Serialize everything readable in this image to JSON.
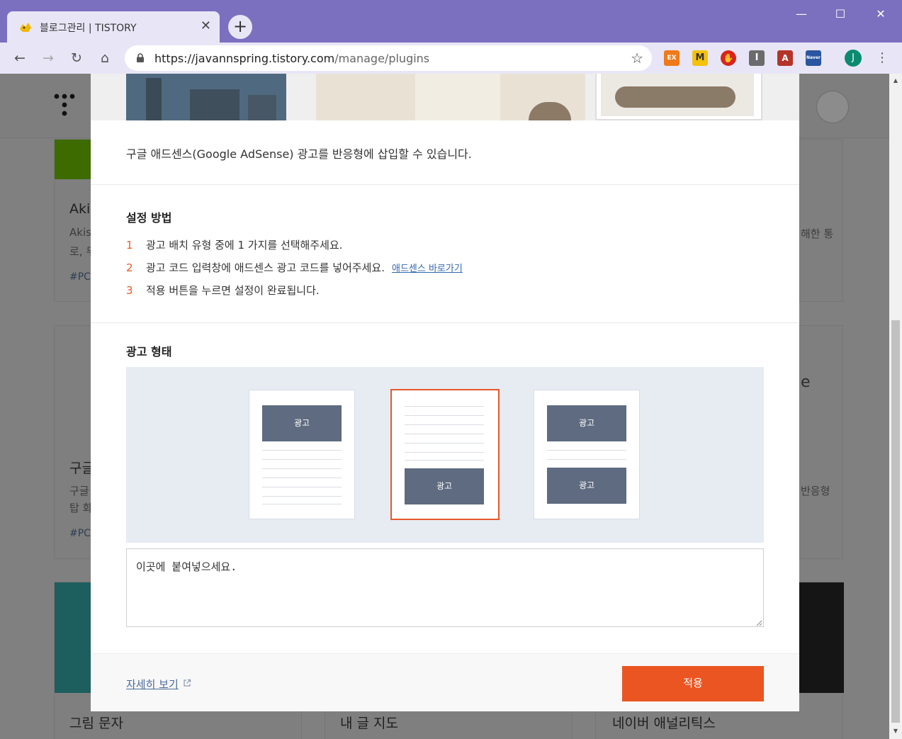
{
  "browser": {
    "tab_title": "블로그관리 | TISTORY",
    "tab_close": "✕",
    "new_tab": "+",
    "window": {
      "minimize": "—",
      "maximize": "☐",
      "close": "✕"
    },
    "nav": {
      "back": "←",
      "forward": "→",
      "reload": "↻",
      "home": "⌂"
    },
    "url_host": "https://javannspring.tistory.com",
    "url_path": "/manage/plugins",
    "bookmark_star": "☆",
    "extensions": [
      {
        "label": "EX",
        "color": "#f07a1a"
      },
      {
        "label": "M",
        "color": "#f4c20d"
      },
      {
        "label": "✋",
        "color": "#d8241c"
      },
      {
        "label": "I",
        "color": "#6b6b6b"
      },
      {
        "label": "A",
        "color": "#b5342a"
      },
      {
        "label": "Naver",
        "color": "#2a56a0"
      }
    ],
    "profile_initial": "J",
    "menu": "⋮"
  },
  "background_page": {
    "cards_left": [
      {
        "title": "Akis",
        "desc1": "Akis",
        "desc2": "로, 무",
        "tag": "#PC"
      },
      {
        "title": "구글",
        "desc1": "구글",
        "desc2": "탑 화",
        "tag": "#PC"
      }
    ],
    "right_fragments": [
      "해한 통",
      "e",
      "반응형"
    ],
    "bottom_titles": [
      "그림 문자",
      "내 글 지도",
      "네이버 애널리틱스"
    ]
  },
  "modal": {
    "description": "구글 애드센스(Google AdSense) 광고를 반응형에 삽입할 수 있습니다.",
    "setup_title": "설정 방법",
    "steps": [
      {
        "num": "1",
        "text": "광고 배치 유형 중에 1 가지를 선택해주세요."
      },
      {
        "num": "2",
        "text": "광고 코드 입력창에 애드센스 광고 코드를 넣어주세요.",
        "link": "애드센스 바로가기"
      },
      {
        "num": "3",
        "text": "적용 버튼을 누르면 설정이 완료됩니다."
      }
    ],
    "ad_type_title": "광고 형태",
    "ad_label": "광고",
    "selected_option": 2,
    "code_value": "이곳에 붙여넣으세요.",
    "more_link": "자세히 보기",
    "apply_label": "적용"
  },
  "colors": {
    "accent": "#ea5522",
    "titlebar": "#7b6fc0",
    "ad_block": "#5e6b80"
  }
}
